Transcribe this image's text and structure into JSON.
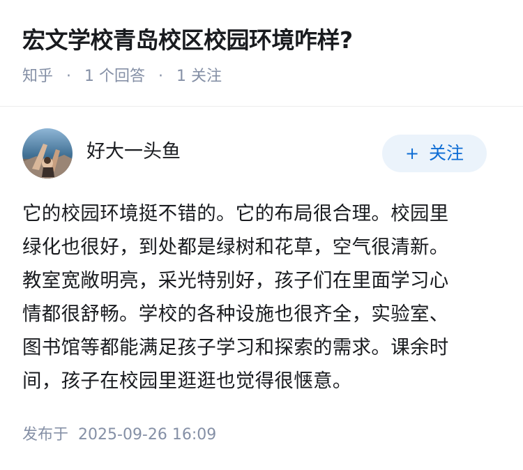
{
  "question": {
    "title": "宏文学校青岛校区校园环境咋样?",
    "source": "知乎",
    "separator": "·",
    "answers": "1 个回答",
    "followers": "1 关注"
  },
  "author": {
    "name": "好大一头鱼",
    "follow_plus": "+",
    "follow_label": "关注"
  },
  "answer": {
    "lines": [
      "它的校园环境挺不错的。它的布局很合理。校园里",
      "绿化也很好，到处都是绿树和花草，空气很清新。",
      "教室宽敞明亮，采光特别好，孩子们在里面学习心",
      "情都很舒畅。学校的各种设施也很齐全，实验室、",
      "图书馆等都能满足孩子学习和探索的需求。课余时",
      "间，孩子在校园里逛逛也觉得很惬意。"
    ]
  },
  "publish": {
    "label": "发布于",
    "time": "2025-09-26 16:09"
  },
  "colors": {
    "accent": "#0d6cd4",
    "button_bg": "#ebf3fb",
    "meta": "#8590a6",
    "text": "#191b1f"
  }
}
